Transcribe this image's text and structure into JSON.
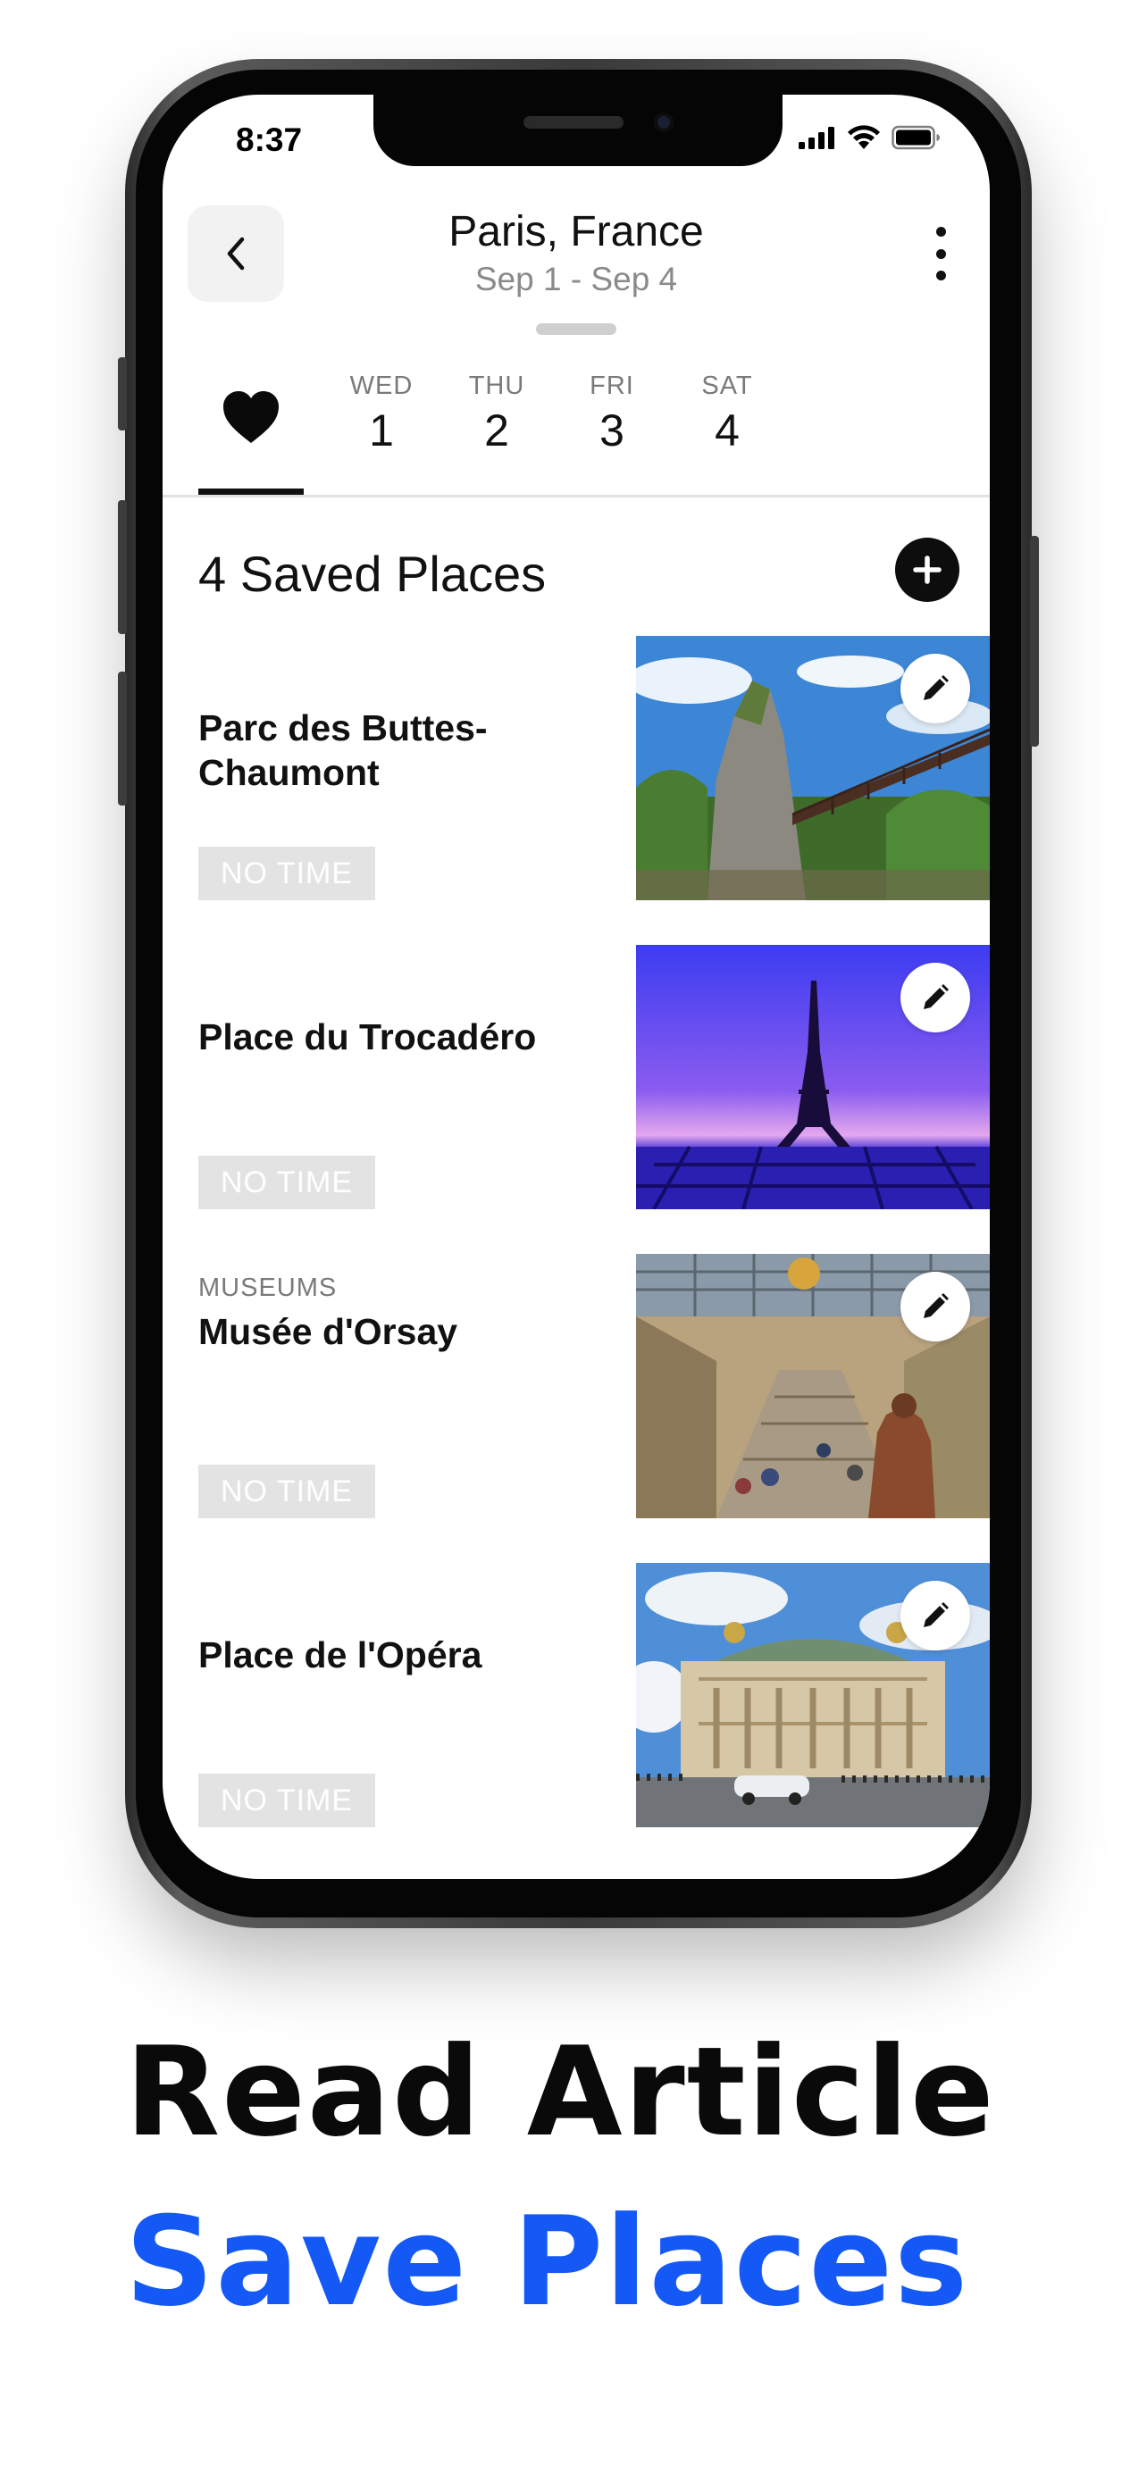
{
  "status_bar": {
    "time": "8:37"
  },
  "header": {
    "title": "Paris, France",
    "subtitle": "Sep 1 - Sep 4"
  },
  "tabs": {
    "favorites_icon": "heart-icon",
    "days": [
      {
        "dow": "WED",
        "dom": "1"
      },
      {
        "dow": "THU",
        "dom": "2"
      },
      {
        "dow": "FRI",
        "dom": "3"
      },
      {
        "dow": "SAT",
        "dom": "4"
      }
    ]
  },
  "saved": {
    "title": "4 Saved Places",
    "places": [
      {
        "category": "",
        "name": "Parc des Buttes-Chaumont",
        "time": "NO TIME",
        "photo": "park-cliff-bridge"
      },
      {
        "category": "",
        "name": "Place du Trocadéro",
        "time": "NO TIME",
        "photo": "eiffel-tower-dusk"
      },
      {
        "category": "MUSEUMS",
        "name": "Musée d'Orsay",
        "time": "NO TIME",
        "photo": "museum-hall"
      },
      {
        "category": "",
        "name": "Place de l'Opéra",
        "time": "NO TIME",
        "photo": "opera-facade"
      }
    ]
  },
  "marketing": {
    "line1": "Read Article",
    "line2": "Save Places"
  },
  "colors": {
    "accent_blue": "#1459f5",
    "badge_gray": "#e3e3e3"
  }
}
